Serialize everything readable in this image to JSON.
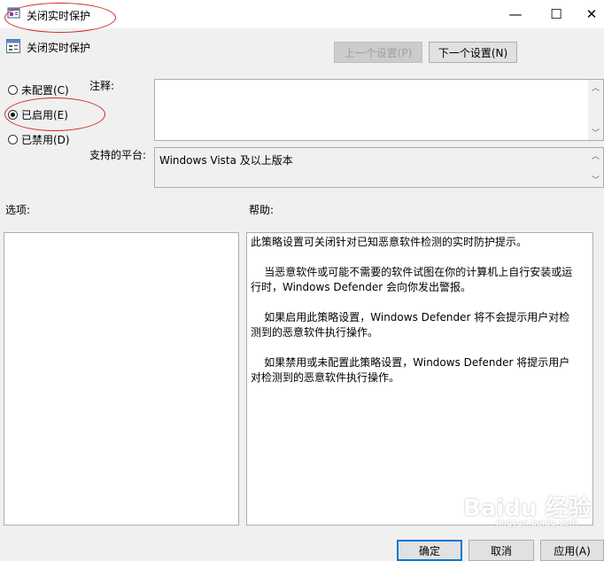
{
  "window": {
    "title": "关闭实时保护",
    "minimize_glyph": "—",
    "maximize_glyph": "☐",
    "close_glyph": "✕"
  },
  "header": {
    "setting_name": "关闭实时保护",
    "prev_button": "上一个设置(P)",
    "next_button": "下一个设置(N)"
  },
  "radios": {
    "not_configured": "未配置(C)",
    "enabled": "已启用(E)",
    "disabled": "已禁用(D)",
    "selected": "enabled"
  },
  "comment": {
    "label": "注释:",
    "value": ""
  },
  "platform": {
    "label": "支持的平台:",
    "value": "Windows Vista 及以上版本"
  },
  "options": {
    "label": "选项:"
  },
  "help": {
    "label": "帮助:",
    "text": "此策略设置可关闭针对已知恶意软件检测的实时防护提示。\n\n    当恶意软件或可能不需要的软件试图在你的计算机上自行安装或运行时，Windows Defender 会向你发出警报。\n\n    如果启用此策略设置，Windows Defender 将不会提示用户对检测到的恶意软件执行操作。\n\n    如果禁用或未配置此策略设置，Windows Defender 将提示用户对检测到的恶意软件执行操作。"
  },
  "footer": {
    "ok_button": "确定",
    "cancel_button": "取消",
    "apply_button": "应用(A)"
  },
  "watermark": {
    "text": "Baidu 经验",
    "sub": "jingyan.baidu.com"
  },
  "colors": {
    "annotation": "#d32525",
    "button_focus": "#0078d7"
  }
}
